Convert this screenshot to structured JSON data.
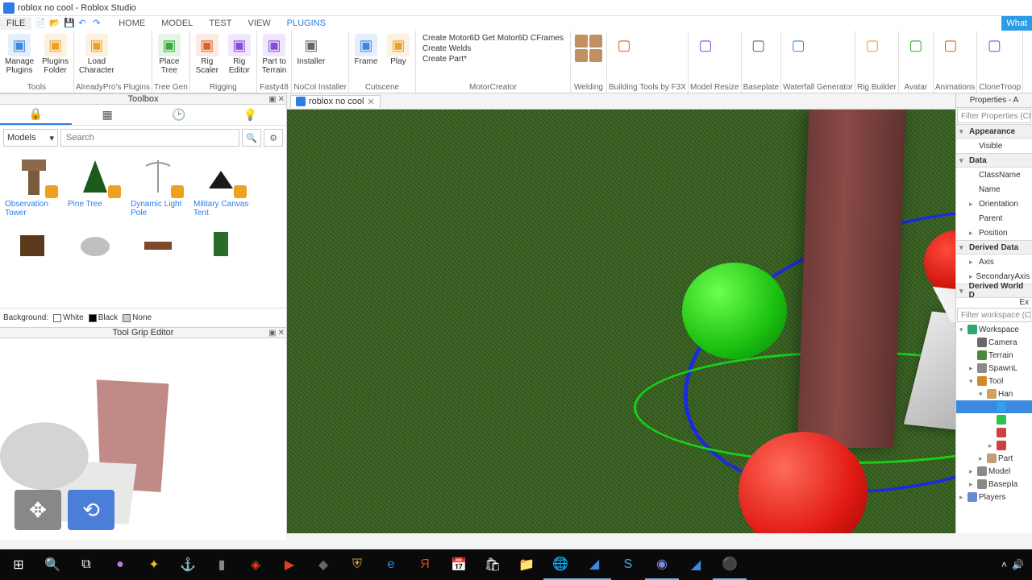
{
  "window": {
    "title": "roblox no cool - Roblox Studio"
  },
  "menu": {
    "file": "FILE",
    "tabs": [
      "HOME",
      "MODEL",
      "TEST",
      "VIEW",
      "PLUGINS"
    ],
    "active": "PLUGINS",
    "whats": "What"
  },
  "ribbon": {
    "groups": [
      {
        "label": "Tools",
        "buttons": [
          {
            "label": "Manage\nPlugins"
          },
          {
            "label": "Plugins\nFolder"
          }
        ]
      },
      {
        "label": "AlreadyPro's Plugins",
        "buttons": [
          {
            "label": "Load\nCharacter"
          }
        ]
      },
      {
        "label": "Tree Gen",
        "buttons": [
          {
            "label": "Place\nTree"
          }
        ]
      },
      {
        "label": "Rigging",
        "buttons": [
          {
            "label": "Rig\nScaler"
          },
          {
            "label": "Rig\nEditor"
          }
        ]
      },
      {
        "label": "Fasty48",
        "buttons": [
          {
            "label": "Part to\nTerrain"
          }
        ]
      },
      {
        "label": "NoCol Installer",
        "buttons": [
          {
            "label": "Installer"
          }
        ]
      },
      {
        "label": "Cutscene",
        "buttons": [
          {
            "label": "Frame"
          },
          {
            "label": "Play"
          }
        ]
      },
      {
        "label": "MotorCreator",
        "stack": [
          "Create Motor6D   Get Motor6D CFrames",
          "Create Welds",
          "Create Part*"
        ]
      },
      {
        "label": "Welding",
        "icons": true
      },
      {
        "label": "Building Tools by F3X"
      },
      {
        "label": "Model Resize"
      },
      {
        "label": "Baseplate"
      },
      {
        "label": "Waterfall Generator"
      },
      {
        "label": "Rig Builder"
      },
      {
        "label": "Avatar"
      },
      {
        "label": "Animations"
      },
      {
        "label": "CloneTroop"
      }
    ]
  },
  "toolbox": {
    "title": "Toolbox",
    "dropdown": "Models",
    "search_ph": "Search",
    "items": [
      {
        "name": "Observation Tower"
      },
      {
        "name": "Pine Tree"
      },
      {
        "name": "Dynamic Light Pole"
      },
      {
        "name": "Military Canvas Tent"
      }
    ],
    "bg_label": "Background:",
    "bg_opts": [
      "White",
      "Black",
      "None"
    ]
  },
  "tge": {
    "title": "Tool Grip Editor"
  },
  "doc_tab": {
    "name": "roblox no cool"
  },
  "properties": {
    "title": "Properties - A",
    "filter_ph": "Filter Properties (Ct",
    "cats": [
      {
        "name": "Appearance",
        "items": [
          "Visible"
        ]
      },
      {
        "name": "Data",
        "items": [
          "ClassName",
          "Name",
          "Orientation",
          "Parent",
          "Position"
        ]
      },
      {
        "name": "Derived Data",
        "items": [
          "Axis",
          "SecondaryAxis"
        ]
      },
      {
        "name": "Derived World D",
        "items": []
      }
    ],
    "ex": "Ex"
  },
  "explorer": {
    "filter_ph": "Filter workspace (Ctr",
    "tree": [
      {
        "label": "Workspace",
        "ico": "#2ea86e",
        "ind": 0,
        "ex": true
      },
      {
        "label": "Camera",
        "ico": "#6a6a6a",
        "ind": 1
      },
      {
        "label": "Terrain",
        "ico": "#4a8a3a",
        "ind": 1
      },
      {
        "label": "SpawnL",
        "ico": "#8a8a8a",
        "ind": 1,
        "ex": false
      },
      {
        "label": "Tool",
        "ico": "#d08a2a",
        "ind": 1,
        "ex": true
      },
      {
        "label": "Han",
        "ico": "#d0a060",
        "ind": 2,
        "ex": true
      },
      {
        "label": "",
        "ico": "#30a0f0",
        "ind": 3,
        "sel": true
      },
      {
        "label": "",
        "ico": "#30c050",
        "ind": 3
      },
      {
        "label": "",
        "ico": "#d04040",
        "ind": 3
      },
      {
        "label": "",
        "ico": "#d04040",
        "ind": 3,
        "ex": false
      },
      {
        "label": "Part",
        "ico": "#c0a070",
        "ind": 2,
        "ex": false
      },
      {
        "label": "Model",
        "ico": "#8a8a8a",
        "ind": 1,
        "ex": false
      },
      {
        "label": "Basepla",
        "ico": "#8a8a8a",
        "ind": 1,
        "ex": false
      },
      {
        "label": "Players",
        "ico": "#6a8ad0",
        "ind": 0,
        "ex": false
      }
    ]
  }
}
